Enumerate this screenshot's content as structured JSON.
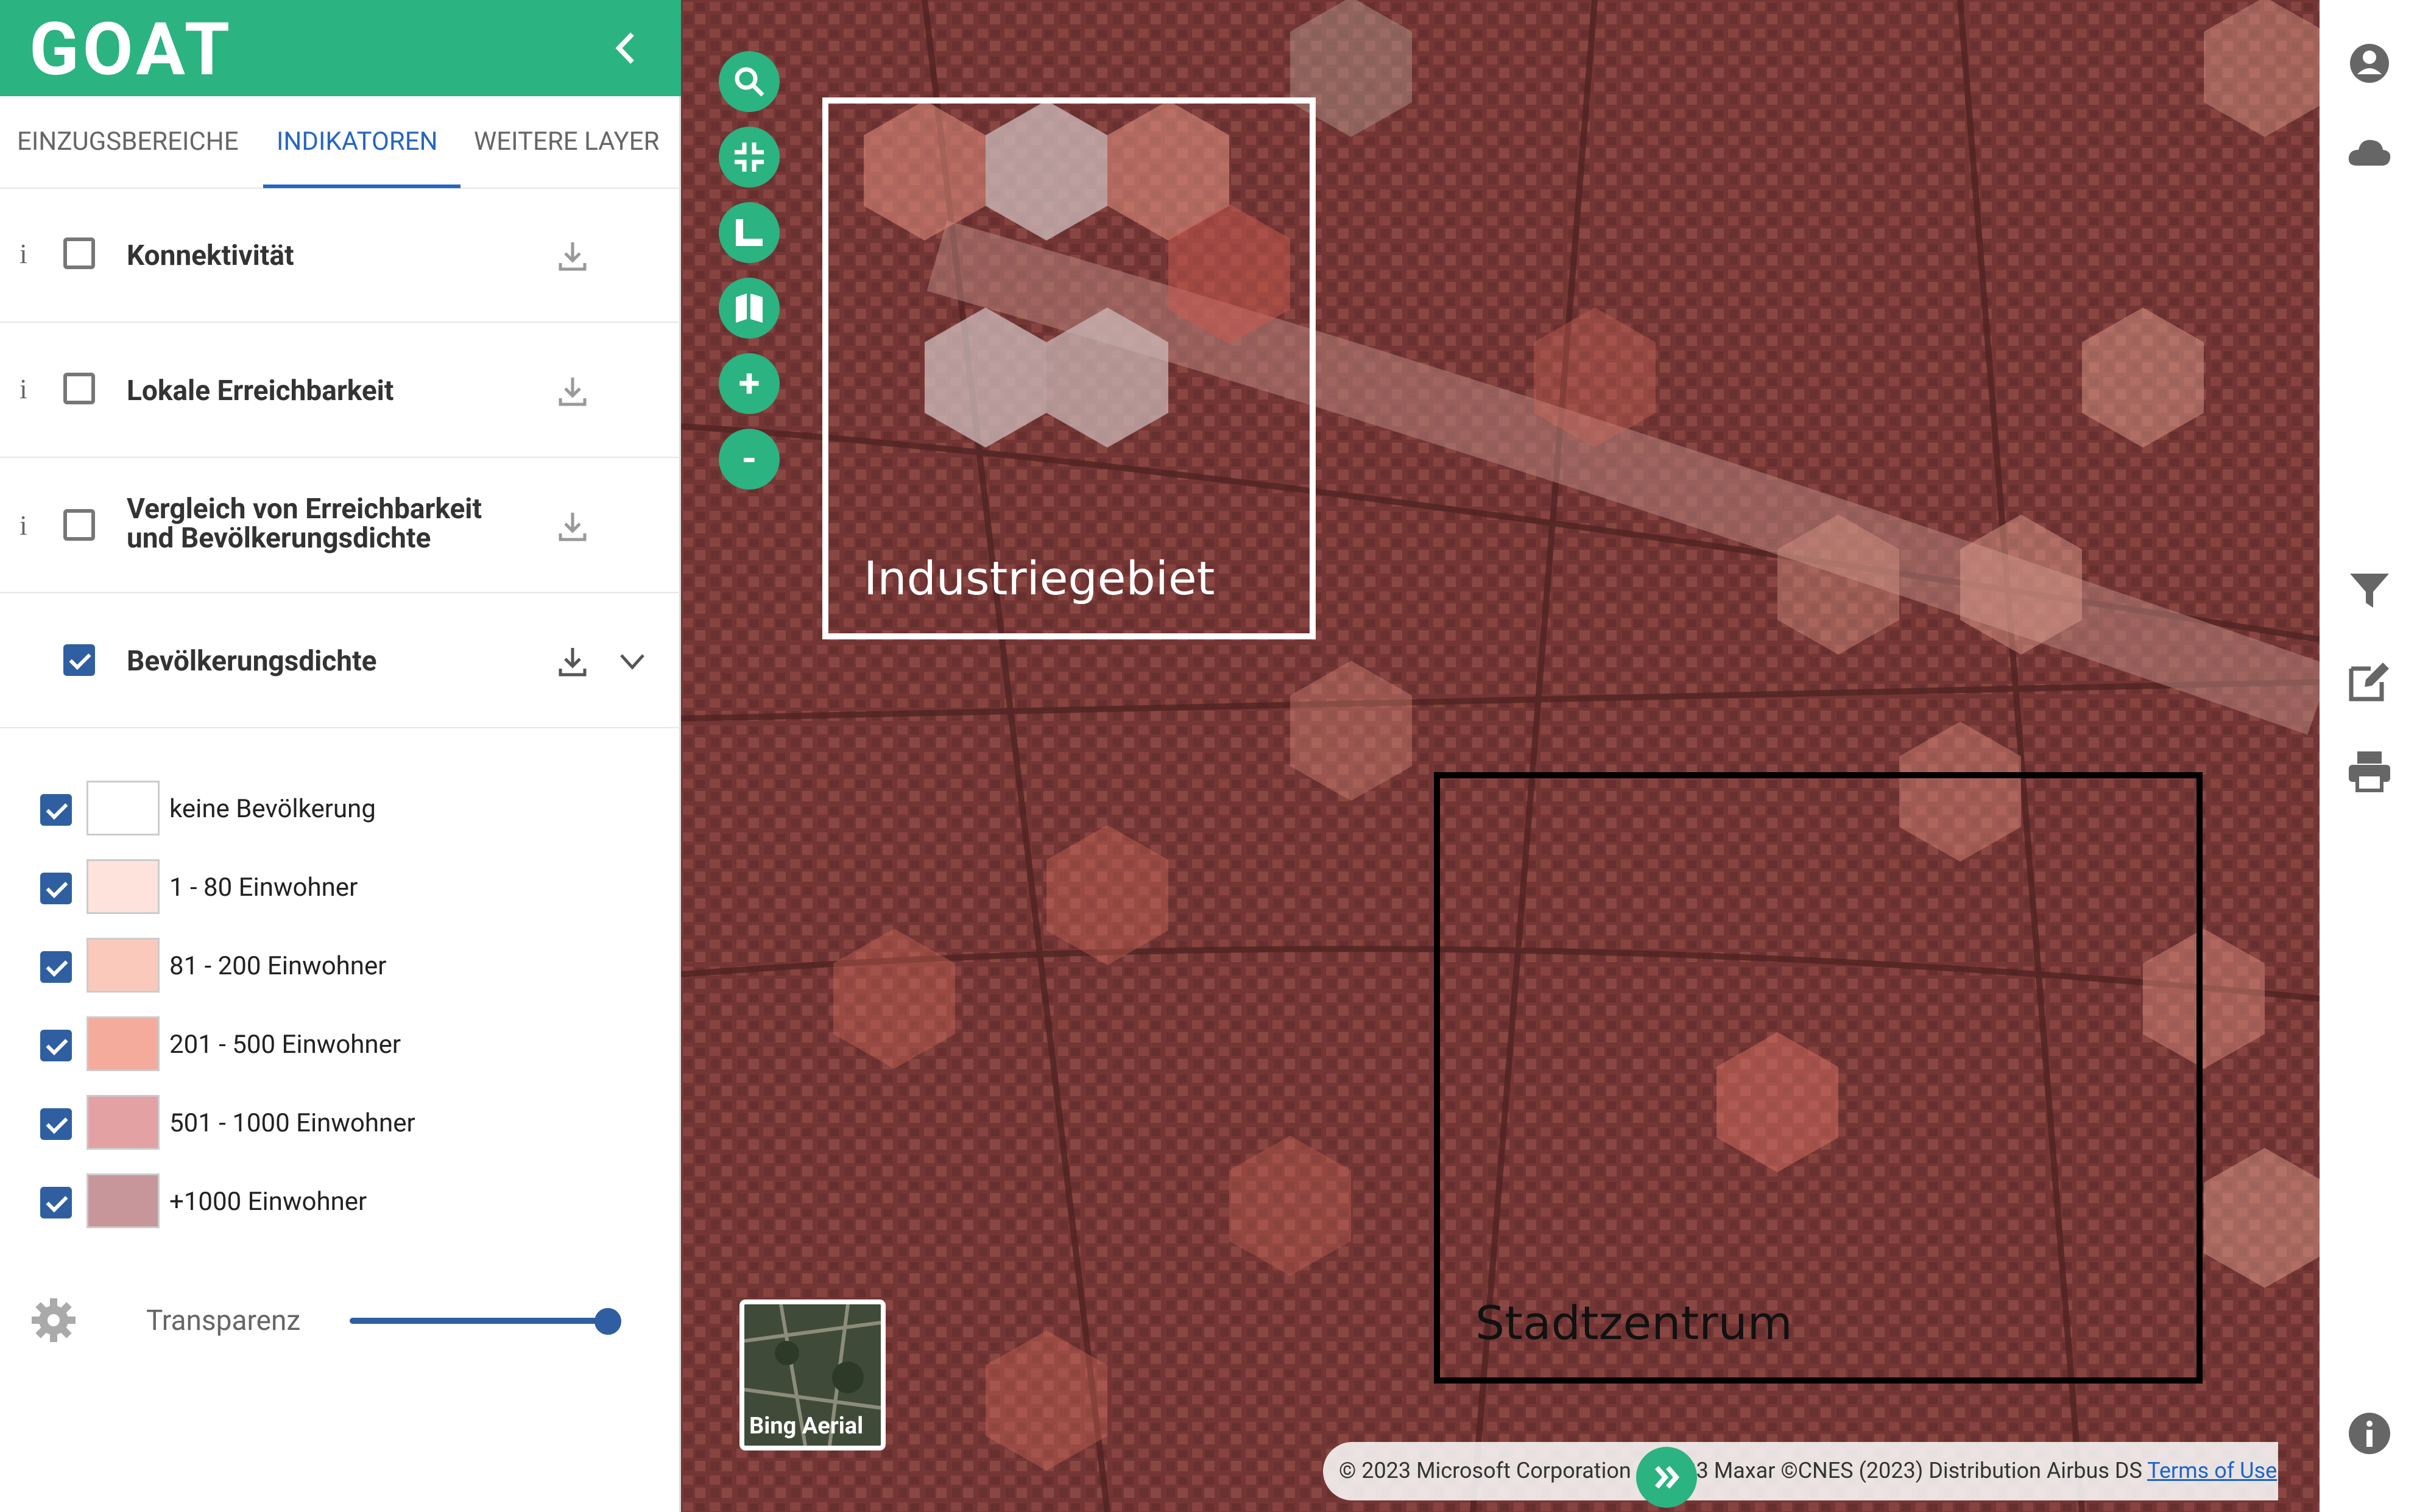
{
  "app": {
    "logo": "GOAT",
    "collapse_icon": "chevron-left-icon",
    "accent": "#2bb381",
    "primary": "#2f5fa0"
  },
  "tabs": [
    {
      "label": "EINZUGSBEREICHE",
      "active": false
    },
    {
      "label": "INDIKATOREN",
      "active": true
    },
    {
      "label": "WEITERE LAYER",
      "active": false
    }
  ],
  "layers": [
    {
      "info": "i",
      "label": "Konnektivität",
      "checked": false
    },
    {
      "info": "i",
      "label": "Lokale Erreichbarkeit",
      "checked": false
    },
    {
      "info": "i",
      "label": "Vergleich von Erreichbarkeit und Bevölkerungsdichte",
      "checked": false
    },
    {
      "label": "Bevölkerungsdichte",
      "checked": true,
      "expanded": true
    }
  ],
  "legend": [
    {
      "label": "keine Bevölkerung",
      "color": "#ffffff",
      "checked": true
    },
    {
      "label": "1 - 80 Einwohner",
      "color": "#fde3dc",
      "checked": true
    },
    {
      "label": "81 - 200 Einwohner",
      "color": "#fbc9bc",
      "checked": true
    },
    {
      "label": "201 - 500 Einwohner",
      "color": "#f5ab9c",
      "checked": true
    },
    {
      "label": "501 - 1000 Einwohner",
      "color": "#e3a1a4",
      "checked": true
    },
    {
      "label": "+1000 Einwohner",
      "color": "#c7969b",
      "checked": true
    }
  ],
  "transparency": {
    "label": "Transparenz",
    "value": 1.0
  },
  "map": {
    "controls": [
      "search-icon",
      "fullscreen-exit-icon",
      "measure-icon",
      "map-legend-icon",
      "zoom-in-icon",
      "zoom-out-icon"
    ],
    "zoom_in": "+",
    "zoom_out": "-",
    "annotations": {
      "industry": "Industriegebiet",
      "center": "Stadtzentrum"
    },
    "basemap_label": "Bing Aerial",
    "attribution": "© 2023 Microsoft Corporation © 2023 Maxar ©CNES (2023) Distribution Airbus DS",
    "attribution_link": "Terms of Use"
  },
  "rail_icons": [
    "account-icon",
    "cloud-icon",
    "filter-icon",
    "edit-icon",
    "print-icon",
    "info-icon"
  ]
}
